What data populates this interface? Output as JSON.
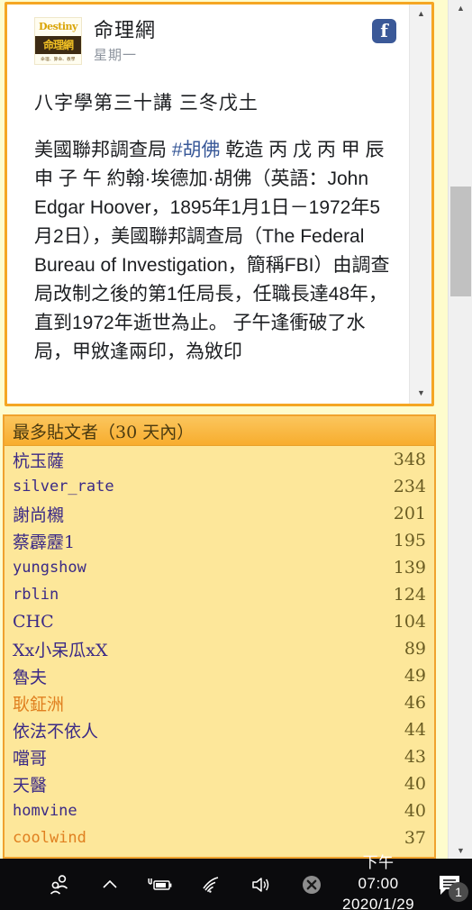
{
  "post": {
    "logo": {
      "top_text": "Destiny",
      "mid_text": "命理網",
      "bottom_text": "命理、算命、教學"
    },
    "page_name": "命理網",
    "time": "星期一",
    "fb_badge": "f",
    "title": "八字學第三十講 三冬戊土",
    "body_before_tag": "美國聯邦調查局 ",
    "tag": "#胡佛",
    "body_after_tag": " 乾造 丙 戊 丙 甲 辰 申 子 午 約翰·埃德加·胡佛（英語：John Edgar Hoover，1895年1月1日－1972年5月2日），美國聯邦調查局（The Federal Bureau of Investigation，簡稱FBI）由調查局改制之後的第1任局長，任職長達48年，直到1972年逝世為止。 子午逢衝破了水局，甲敓逢兩印，為敓印"
  },
  "scrollbars": {
    "up_arrow": "▲",
    "down_arrow": "▼"
  },
  "top_posters": {
    "header": "最多貼文者（30 天內）",
    "rows": [
      {
        "name": "杭玉薩",
        "count": "348",
        "style": "cjk"
      },
      {
        "name": "silver_rate",
        "count": "234",
        "style": "mono"
      },
      {
        "name": "謝尚櫬",
        "count": "201",
        "style": "cjk"
      },
      {
        "name": "蔡霹靂1",
        "count": "195",
        "style": "cjk"
      },
      {
        "name": "yungshow",
        "count": "139",
        "style": "mono"
      },
      {
        "name": "rblin",
        "count": "124",
        "style": "mono"
      },
      {
        "name": "CHC",
        "count": "104",
        "style": "cjk"
      },
      {
        "name": "Xx小呆瓜xX",
        "count": "89",
        "style": "cjk"
      },
      {
        "name": "魯夫",
        "count": "49",
        "style": "cjk"
      },
      {
        "name": "耿鉦洲",
        "count": "46",
        "style": "orange"
      },
      {
        "name": "依法不依人",
        "count": "44",
        "style": "cjk"
      },
      {
        "name": "噹哥",
        "count": "43",
        "style": "cjk"
      },
      {
        "name": "天醫",
        "count": "40",
        "style": "cjk"
      },
      {
        "name": "homvine",
        "count": "40",
        "style": "mono"
      },
      {
        "name": "coolwind",
        "count": "37",
        "style": "mono-orange"
      }
    ]
  },
  "taskbar": {
    "icons": [
      "people-icon",
      "chevron-up-icon",
      "battery-charging-icon",
      "wifi-icon",
      "speaker-icon",
      "error-x-icon"
    ],
    "time": "下午 07:00",
    "date": "2020/1/29",
    "notification_count": "1"
  }
}
